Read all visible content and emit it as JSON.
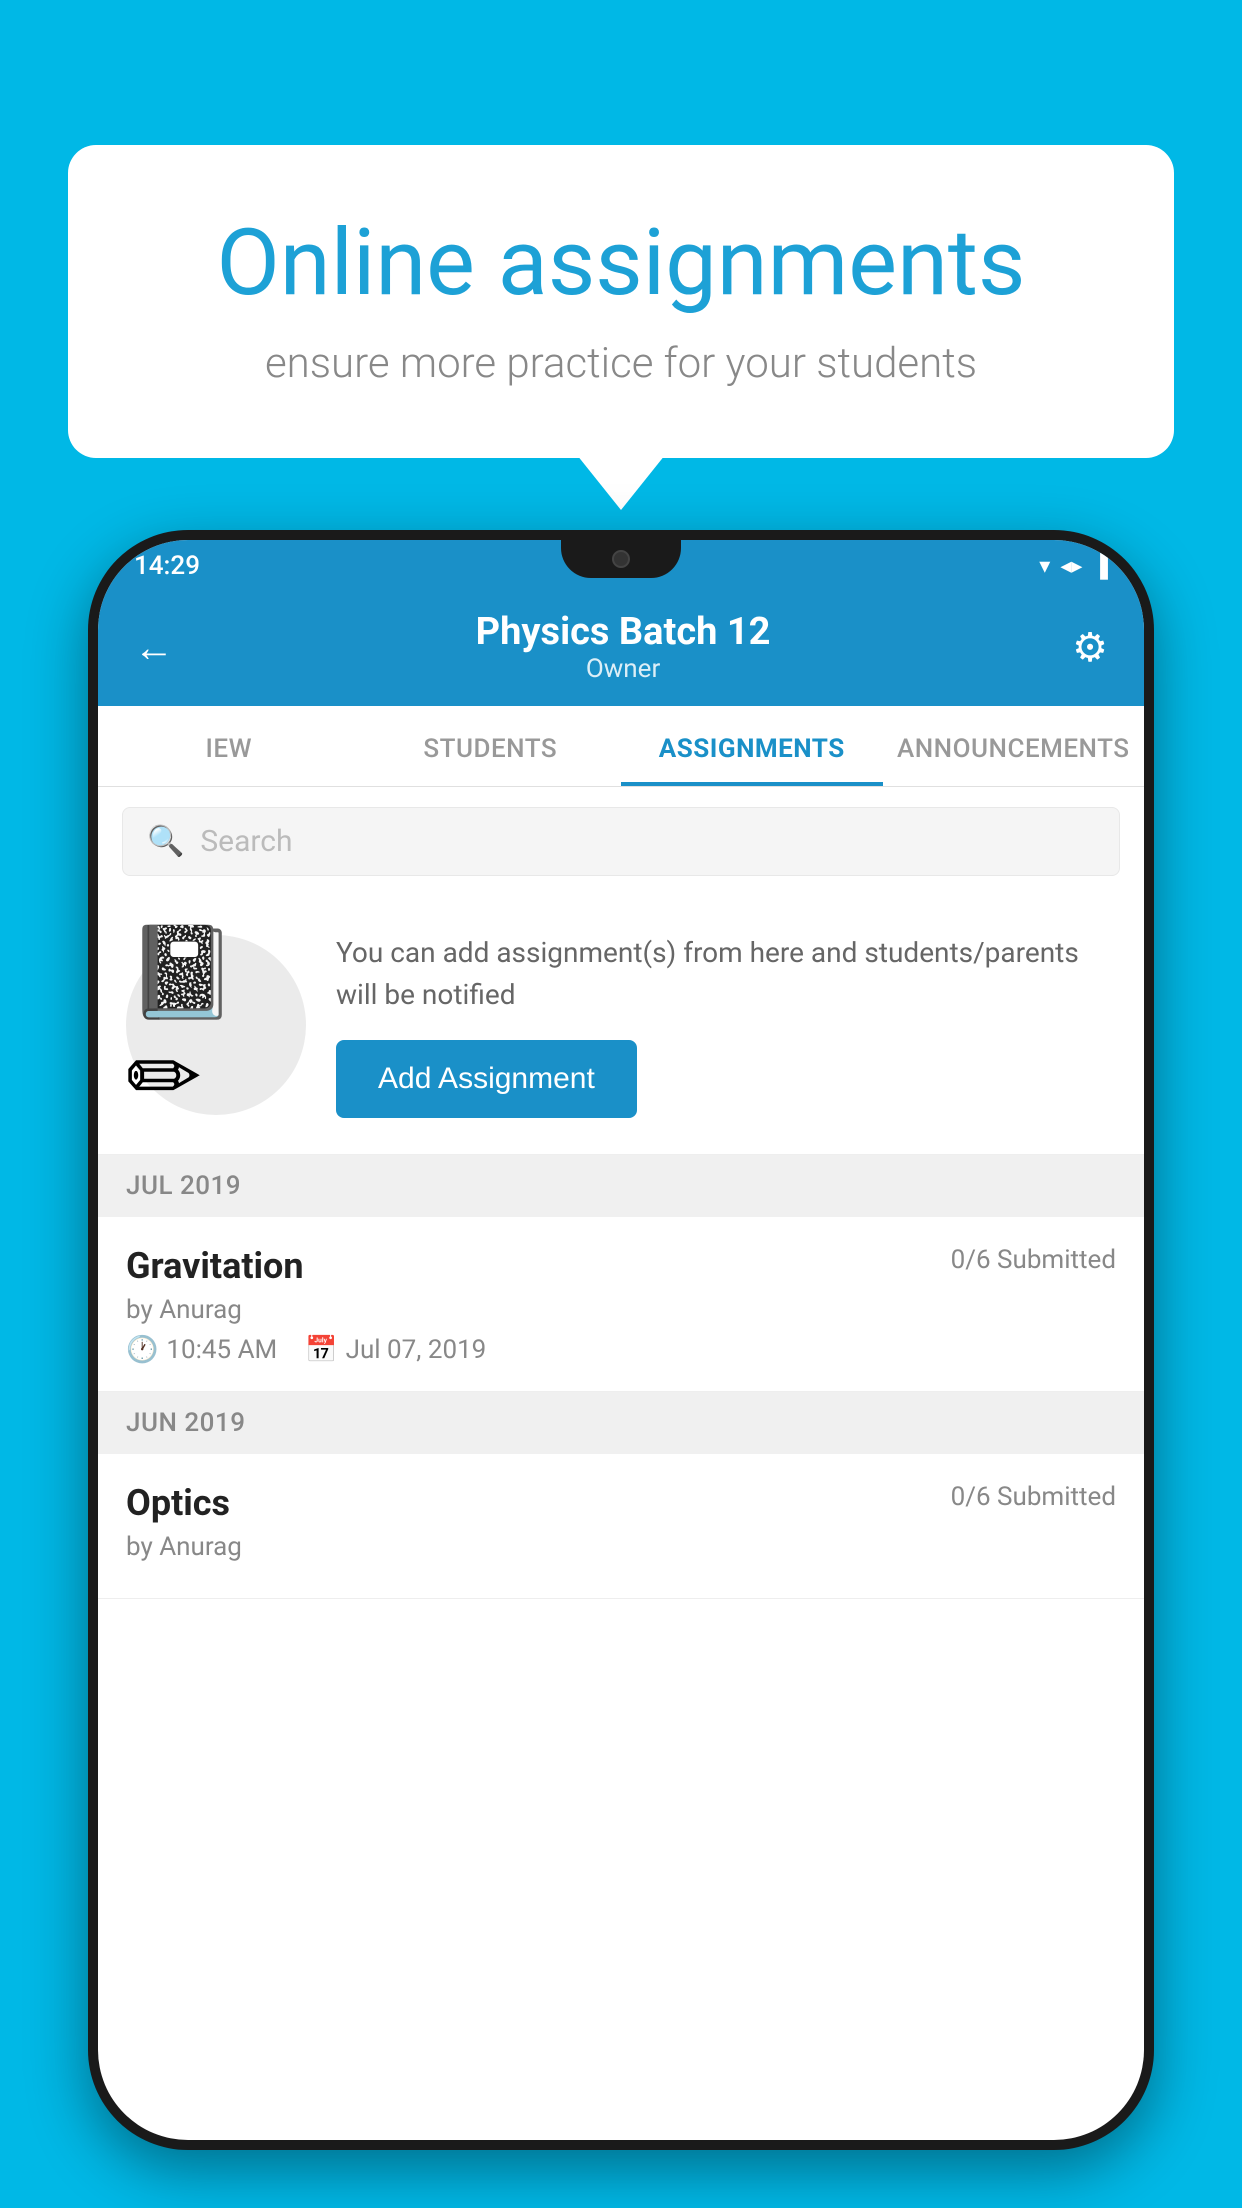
{
  "background_color": "#00b8e6",
  "speech_bubble": {
    "title": "Online assignments",
    "subtitle": "ensure more practice for your students"
  },
  "status_bar": {
    "time": "14:29",
    "icons": "▼◀▌"
  },
  "app_header": {
    "title": "Physics Batch 12",
    "subtitle": "Owner",
    "back_label": "←",
    "settings_label": "⚙"
  },
  "tabs": [
    {
      "label": "IEW",
      "active": false
    },
    {
      "label": "STUDENTS",
      "active": false
    },
    {
      "label": "ASSIGNMENTS",
      "active": true
    },
    {
      "label": "ANNOUNCEMENTS",
      "active": false
    }
  ],
  "search": {
    "placeholder": "Search"
  },
  "promo": {
    "description": "You can add assignment(s) from here and students/parents will be notified",
    "button_label": "Add Assignment"
  },
  "sections": [
    {
      "month_label": "JUL 2019",
      "assignments": [
        {
          "title": "Gravitation",
          "submitted": "0/6 Submitted",
          "by": "by Anurag",
          "time": "10:45 AM",
          "date": "Jul 07, 2019"
        }
      ]
    },
    {
      "month_label": "JUN 2019",
      "assignments": [
        {
          "title": "Optics",
          "submitted": "0/6 Submitted",
          "by": "by Anurag",
          "time": "",
          "date": ""
        }
      ]
    }
  ]
}
